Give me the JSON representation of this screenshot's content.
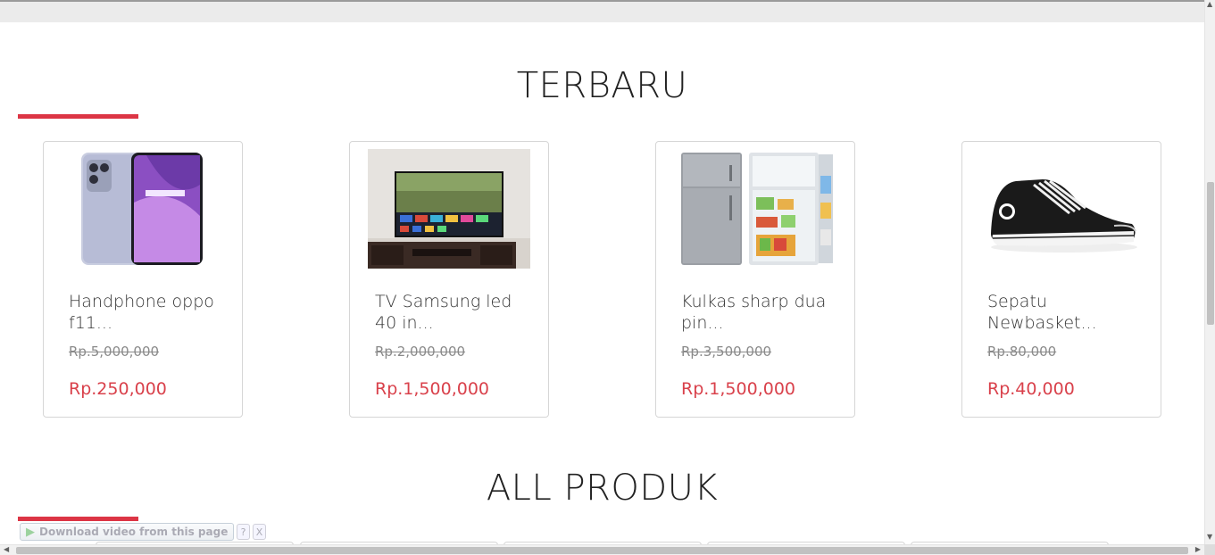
{
  "sections": {
    "newest_title": "TERBARU",
    "all_title": "ALL PRODUK"
  },
  "colors": {
    "accent": "#dc3545",
    "price": "#d9414b"
  },
  "products": [
    {
      "name": "Handphone oppo f11...",
      "old_price": "Rp.5,000,000",
      "price": "Rp.250,000",
      "image": "smartphone-image"
    },
    {
      "name": "TV Samsung led 40 in...",
      "old_price": "Rp.2,000,000",
      "price": "Rp.1,500,000",
      "image": "tv-image"
    },
    {
      "name": "Kulkas sharp dua pin...",
      "old_price": "Rp.3,500,000",
      "price": "Rp.1,500,000",
      "image": "refrigerator-image"
    },
    {
      "name": "Sepatu Newbasket...",
      "old_price": "Rp.80,000",
      "price": "Rp.40,000",
      "image": "sneaker-image"
    }
  ],
  "download_bar": {
    "label": "Download video from this page",
    "help": "?",
    "close": "X"
  }
}
